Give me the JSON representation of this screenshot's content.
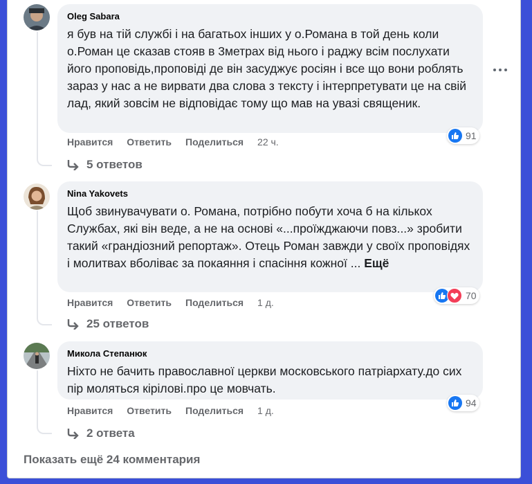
{
  "comments": [
    {
      "author": "Oleg Sabara",
      "text": "я був на тій службі і на багатьох інших у о.Романа в той день коли о.Роман це сказав стояв в 3метрах від нього і раджу всім послухати його проповідь,проповіді де він засуджує росіян і все що вони роблять зараз у нас а не вирвати два слова з тексту і інтерпретувати це на свій лад, який зовсім не відповідає тому що мав на увазі священик.",
      "like": "Нравится",
      "reply": "Ответить",
      "share": "Поделиться",
      "time": "22 ч.",
      "reactions": "91",
      "replies": "5 ответов",
      "avatar_icon": "man-avatar"
    },
    {
      "author": "Nina Yakovets",
      "text": "Щоб звинувачувати о. Романа, потрібно побути хоча б на кількох Службах, які він веде, а не на основі «...проїжджаючи повз...» зробити такий «грандіозний репортаж». Отець Роман завжди у своїх проповідях і молитвах вболіває за покаяння і спасіння кожної ...",
      "see_more": "Ещё",
      "like": "Нравится",
      "reply": "Ответить",
      "share": "Поделиться",
      "time": "1 д.",
      "reactions": "70",
      "replies": "25 ответов",
      "avatar_icon": "woman-avatar"
    },
    {
      "author": "Микола Степанюк",
      "text": "Ніхто не бачить православної церкви московського патріархату.до сих пір моляться кірілові.про це мовчать.",
      "like": "Нравится",
      "reply": "Ответить",
      "share": "Поделиться",
      "time": "1 д.",
      "reactions": "94",
      "replies": "2 ответа",
      "avatar_icon": "road-avatar"
    }
  ],
  "show_more": "Показать ещё 24 комментария",
  "colors": {
    "like": "#1877f2",
    "love": "#f33e58",
    "bubble": "#f0f2f5",
    "frame": "#3b4fd8"
  }
}
